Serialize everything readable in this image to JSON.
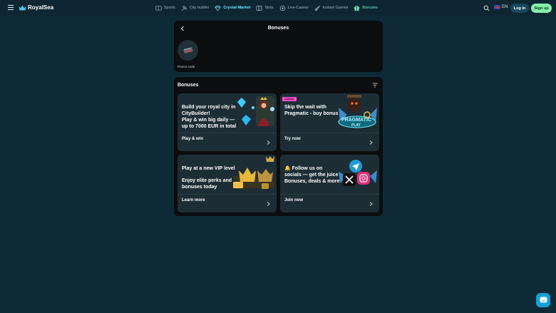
{
  "header": {
    "brand": "RoyalSea",
    "nav": [
      {
        "label": "Sports",
        "icon": "sports-icon"
      },
      {
        "label": "City builder",
        "icon": "hammer-icon"
      },
      {
        "label": "Crystal Market",
        "icon": "diamond-icon"
      },
      {
        "label": "Slots",
        "icon": "slots-icon"
      },
      {
        "label": "Live-Casino",
        "icon": "live-casino-icon"
      },
      {
        "label": "Instant Games",
        "icon": "rocket-icon"
      },
      {
        "label": "Bonuses",
        "icon": "gift-icon"
      }
    ],
    "language": "EN",
    "login_label": "Log in",
    "signup_label": "Sign up"
  },
  "promo_panel": {
    "title": "Bonuses",
    "promo_label": "Promo code"
  },
  "bonuses": {
    "title": "Bonuses",
    "cards": [
      {
        "lines": [
          "Build your royal city in",
          "CityBuilder!",
          "Play & win big daily —",
          "up to 7000 EUR in total"
        ],
        "cta": "Play & win",
        "art": "queen-gems-art"
      },
      {
        "badge": "CASINO",
        "lines": [
          "Skip the wait with",
          "Pragmatic - buy bonus"
        ],
        "cta": "Try now",
        "art": "pragmatic-play-art"
      },
      {
        "lines": [
          "Play at a new VIP level",
          "",
          "Enjoy elite perks and",
          "bonuses today"
        ],
        "cta": "Learn more",
        "art": "gold-crowns-art"
      },
      {
        "lines": [
          "🔔 Follow us on",
          "socials — get the juice",
          "Bonuses, deals & more"
        ],
        "cta": "Join now",
        "art": "social-icons-art"
      }
    ]
  },
  "colors": {
    "background": "#0f2a37",
    "panel": "#0b0d0f",
    "card": "#1d2d35",
    "accent_green": "#86f0a9",
    "active_nav": "#7cf0c6",
    "casino_badge": "#ff4fd2",
    "chat": "#14a0d6"
  }
}
